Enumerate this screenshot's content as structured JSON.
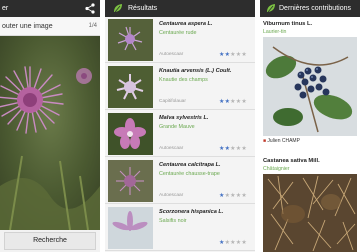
{
  "panel_identify": {
    "title": "er",
    "share_icon": "share-icon",
    "add_image_label": "outer une image",
    "counter": "1/4",
    "search_label": "Recherche"
  },
  "panel_results": {
    "title": "Résultats",
    "logo_icon": "leaf-logo-icon",
    "results": [
      {
        "scientific": "Centaurea aspera L.",
        "common": "Centaurée rude",
        "organ": "Autoescaar",
        "stars": 2
      },
      {
        "scientific": "Knautia arvensis (L.) Coult.",
        "common": "Knautie des champs",
        "organ": "Capitifolauar",
        "stars": 2
      },
      {
        "scientific": "Malva sylvestris L.",
        "common": "Grande Mauve",
        "organ": "Autoescaar",
        "stars": 2
      },
      {
        "scientific": "Centaurea calcitrapa L.",
        "common": "Centaurée chausse-trape",
        "organ": "Autoescaar",
        "stars": 1
      },
      {
        "scientific": "Scorzonera hispanica L.",
        "common": "Salsifis noir",
        "organ": "",
        "stars": 1
      }
    ]
  },
  "panel_contrib": {
    "title": "Dernières contributions",
    "logo_icon": "leaf-logo-icon",
    "entries": [
      {
        "scientific": "Viburnum tinus L.",
        "common": "Laurier-tin",
        "author": "Julien CHAMP"
      },
      {
        "scientific": "Castanea sativa Mill.",
        "common": "Châtaignier",
        "author": ""
      }
    ]
  },
  "colors": {
    "action_bar": "#2d2d2d",
    "accent_green": "#6aa84f",
    "star_blue": "#4472c4"
  }
}
